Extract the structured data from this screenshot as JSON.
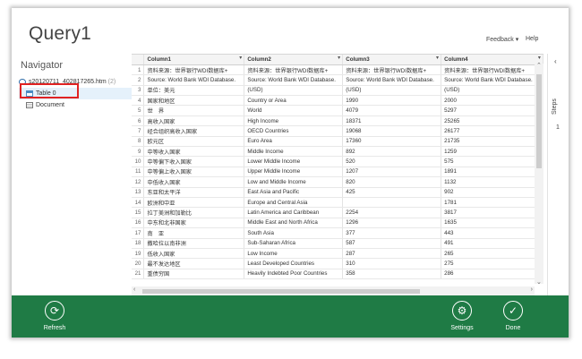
{
  "app": {
    "title": "Query1"
  },
  "top_links": {
    "feedback": "Feedback",
    "help": "Help"
  },
  "navigator": {
    "title": "Navigator",
    "items": [
      {
        "label": "s20120711_402817265.htm",
        "count": "(2)",
        "icon": "file-icon",
        "level": 1,
        "selected": false
      },
      {
        "label": "Table 0",
        "count": "",
        "icon": "table-icon",
        "level": 2,
        "selected": true
      },
      {
        "label": "Document",
        "count": "",
        "icon": "document-icon",
        "level": 2,
        "selected": false
      }
    ]
  },
  "grid": {
    "columns": [
      "Column1",
      "Column2",
      "Column3",
      "Column4"
    ],
    "rows": [
      [
        "1",
        "资料来源：世界银行WDI数据库+",
        "资料来源：世界银行WDI数据库+",
        "资料来源：世界银行WDI数据库+",
        "资料来源：世界银行WDI数据库+"
      ],
      [
        "2",
        "Source: World Bank WDI Database.",
        "Source: World Bank WDI Database.",
        "Source: World Bank WDI Database.",
        "Source: World Bank WDI Database."
      ],
      [
        "3",
        "单位：美元",
        "(USD)",
        "(USD)",
        "(USD)"
      ],
      [
        "4",
        "国家和地区",
        "Country or Area",
        "1990",
        "2000"
      ],
      [
        "5",
        "世　界",
        "World",
        "4079",
        "5297"
      ],
      [
        "6",
        "高收入国家",
        "High Income",
        "18371",
        "25265"
      ],
      [
        "7",
        "经合组织高收入国家",
        "OECD Countries",
        "19068",
        "26177"
      ],
      [
        "8",
        "欧元区",
        "Euro Area",
        "17360",
        "21735"
      ],
      [
        "9",
        "中等收入国家",
        "Middle Income",
        "892",
        "1259"
      ],
      [
        "10",
        "中等偏下收入国家",
        "Lower Middle Income",
        "520",
        "575"
      ],
      [
        "11",
        "中等偏上收入国家",
        "Upper Middle Income",
        "1207",
        "1891"
      ],
      [
        "12",
        "中低收入国家",
        "Low and Middle Income",
        "820",
        "1132"
      ],
      [
        "13",
        "东亚和太平洋",
        "East Asia and Pacific",
        "425",
        "902"
      ],
      [
        "14",
        "欧洲和中亚",
        "Europe and Central Asia",
        "",
        "1781"
      ],
      [
        "15",
        "拉丁美洲和加勒比",
        "Latin America and Caribbean",
        "2254",
        "3817"
      ],
      [
        "16",
        "中东和北非国家",
        "Middle East and North Africa",
        "1296",
        "1635"
      ],
      [
        "17",
        "南　亚",
        "South Asia",
        "377",
        "443"
      ],
      [
        "18",
        "撒哈拉以南非洲",
        "Sub-Saharan Africa",
        "587",
        "491"
      ],
      [
        "19",
        "低收入国家",
        "Low Income",
        "287",
        "265"
      ],
      [
        "20",
        "最不发达地区",
        "Least Developed Countries",
        "310",
        "275"
      ],
      [
        "21",
        "重债穷国",
        "Heavily Indebted Poor Countries",
        "358",
        "286"
      ]
    ]
  },
  "steps": {
    "label": "Steps",
    "count": "1"
  },
  "bottom": {
    "refresh": "Refresh",
    "settings": "Settings",
    "done": "Done"
  },
  "colors": {
    "accent": "#1f7b45",
    "selection": "#e5f1fb",
    "highlight": "#e02222"
  }
}
